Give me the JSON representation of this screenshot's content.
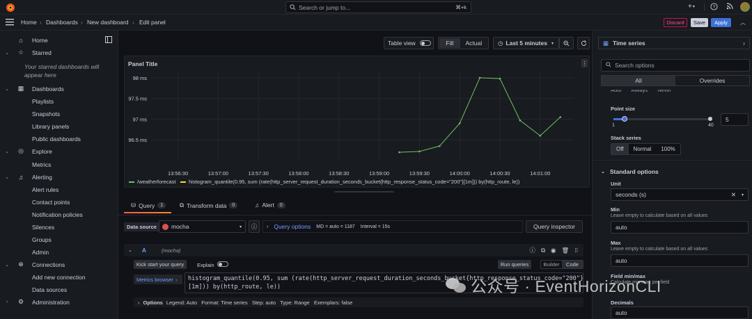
{
  "topbar": {
    "search_placeholder": "Search or jump to...",
    "shortcut": "⌘+k"
  },
  "breadcrumb": {
    "items": [
      "Home",
      "Dashboards",
      "New dashboard",
      "Edit panel"
    ]
  },
  "header_actions": {
    "discard": "Discard",
    "save": "Save",
    "apply": "Apply"
  },
  "sidebar": {
    "home": "Home",
    "starred": "Starred",
    "starred_empty": "Your starred dashboards will appear here",
    "dashboards": "Dashboards",
    "dashboards_children": [
      "Playlists",
      "Snapshots",
      "Library panels",
      "Public dashboards"
    ],
    "explore": "Explore",
    "explore_children": [
      "Metrics"
    ],
    "alerting": "Alerting",
    "alerting_children": [
      "Alert rules",
      "Contact points",
      "Notification policies",
      "Silences",
      "Groups",
      "Admin"
    ],
    "connections": "Connections",
    "connections_children": [
      "Add new connection",
      "Data sources"
    ],
    "administration": "Administration"
  },
  "panel_toolbar": {
    "table_view": "Table view",
    "fill": "Fill",
    "actual": "Actual",
    "time_range": "Last 5 minutes"
  },
  "panel": {
    "title": "Panel Title",
    "legend": [
      {
        "name": "/weatherforecast",
        "color": "#73bf69"
      },
      {
        "name": "histogram_quantile(0.95, sum (rate(http_server_request_duration_seconds_bucket{http_response_status_code=\"200\"}[1m])) by(http_route, le))",
        "color": "#fade2a"
      }
    ]
  },
  "chart_data": {
    "type": "line",
    "ylabels": [
      "98 ms",
      "97.5 ms",
      "97 ms",
      "96.5 ms"
    ],
    "yticks": [
      98,
      97.5,
      97,
      96.5
    ],
    "ylim": [
      96.0,
      98.15
    ],
    "xlabels": [
      "13:56:30",
      "13:57:00",
      "13:57:30",
      "13:58:00",
      "13:58:30",
      "13:59:00",
      "13:59:30",
      "14:00:00",
      "14:00:30",
      "14:01:00"
    ],
    "xtick_seconds": [
      0,
      30,
      60,
      90,
      120,
      150,
      180,
      210,
      240,
      270
    ],
    "xlim_seconds": [
      -20,
      295
    ],
    "series": [
      {
        "name": "/weatherforecast",
        "color": "#73bf69",
        "x_seconds": [
          165,
          180,
          195,
          210,
          225,
          240,
          255,
          270,
          285
        ],
        "y": [
          96.2,
          96.22,
          96.35,
          96.9,
          98.0,
          97.98,
          96.97,
          96.6,
          97.05
        ]
      }
    ]
  },
  "query_tabs": {
    "query": "Query",
    "query_count": "1",
    "transform": "Transform data",
    "transform_count": "0",
    "alert": "Alert",
    "alert_count": "0"
  },
  "query_editor": {
    "data_source_label": "Data source",
    "data_source": "mocha",
    "query_options": "Query options",
    "md": "MD = auto = 1187",
    "interval": "Interval = 15s",
    "query_inspector": "Query inspector",
    "row_letter": "A",
    "row_ds": "(mocha)",
    "kick_start": "Kick start your query",
    "explain": "Explain",
    "run_queries": "Run queries",
    "builder": "Builder",
    "code": "Code",
    "metrics_browser": "Metrics browser",
    "promql_line1": "histogram_quantile(0.95, sum (rate(http_server_request_duration_seconds_bucket{http_response_status_code=\"200\"}",
    "promql_line2": "[1m])) by(http_route, le))",
    "options_label": "Options",
    "options_summary": "Legend: Auto   Format: Time series   Step: auto   Type: Range   Exemplars: false"
  },
  "options_pane": {
    "viz": "Time series",
    "search_placeholder": "Search options",
    "tab_all": "All",
    "tab_overrides": "Overrides",
    "partial_seg": [
      "Auto",
      "Always",
      "Never"
    ],
    "point_size_label": "Point size",
    "point_size_min": "1",
    "point_size_max": "40",
    "point_size_value": "5",
    "stack_series_label": "Stack series",
    "stack_options": [
      "Off",
      "Normal",
      "100%"
    ],
    "standard_options": "Standard options",
    "unit_label": "Unit",
    "unit_value": "seconds (s)",
    "min_label": "Min",
    "min_desc": "Leave empty to calculate based on all values",
    "min_value": "auto",
    "max_label": "Max",
    "max_desc": "Leave empty to calculate based on all values",
    "max_value": "auto",
    "field_minmax_label": "Field min/max",
    "field_minmax_desc": "Calculate min max per field",
    "decimals_label": "Decimals",
    "decimals_value": "auto"
  },
  "watermark": {
    "text": "公众号 · EventHorizonCLI"
  }
}
